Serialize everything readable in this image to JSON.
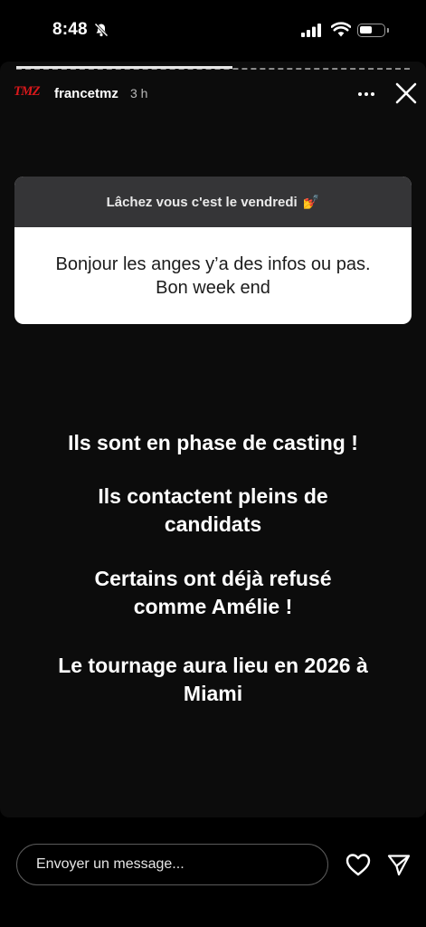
{
  "status_bar": {
    "time": "8:48"
  },
  "story": {
    "progress": 0.55,
    "author": {
      "logo_text": "TMZ",
      "username": "francetmz",
      "time_ago": "3 h"
    },
    "question_card": {
      "prompt": "Lâchez vous c'est le vendredi",
      "prompt_emoji": "💅",
      "answer_line1": "Bonjour les anges y’a des infos ou pas.",
      "answer_line2": "Bon week end"
    },
    "announcement": [
      {
        "line1": "Ils sont en phase de casting !"
      },
      {
        "line1": "Ils contactent pleins de",
        "line2": "candidats"
      },
      {
        "line1": "Certains ont déjà refusé",
        "line2": "comme Amélie !"
      },
      {
        "line1": "Le tournage aura lieu en 2026 à",
        "line2": "Miami"
      }
    ]
  },
  "reply": {
    "placeholder": "Envoyer un message..."
  },
  "icons": {
    "more": "more-icon",
    "close": "close-icon",
    "like": "heart-icon",
    "share": "send-icon"
  }
}
